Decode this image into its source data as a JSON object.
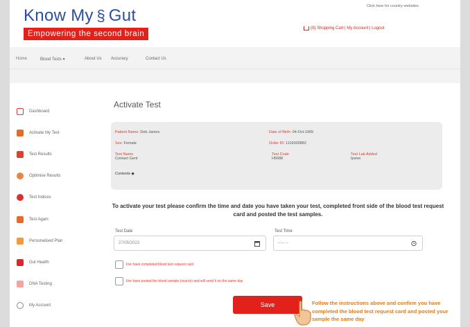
{
  "brand": {
    "name_part1": "Know My",
    "name_part2": "Gut",
    "tagline": "Empowering the second brain",
    "color": "#2a4f9e",
    "tag_color": "#e3211b"
  },
  "header": {
    "lang_link": "Click here for country websites",
    "cart_links": "(0) Shopping Cart | My Account | Logout"
  },
  "nav": {
    "items": [
      "Home",
      "Blood Tests ▾",
      "About Us",
      "Accuracy",
      "Contact Us"
    ]
  },
  "sidebar": {
    "items": [
      {
        "label": "Dashboard",
        "icon": "dashboard-icon"
      },
      {
        "label": "Activate My Test",
        "icon": "activate-icon"
      },
      {
        "label": "Test Results",
        "icon": "results-icon"
      },
      {
        "label": "Optimise Results",
        "icon": "optimise-icon"
      },
      {
        "label": "Test Indices",
        "icon": "indices-icon"
      },
      {
        "label": "Test Again",
        "icon": "test-again-icon"
      },
      {
        "label": "Personalised Plan",
        "icon": "plan-icon"
      },
      {
        "label": "Gut Health",
        "icon": "gut-icon"
      },
      {
        "label": "DNA Testing",
        "icon": "dna-icon"
      },
      {
        "label": "My Account",
        "icon": "account-icon"
      }
    ]
  },
  "main": {
    "title": "Activate Test",
    "patient": {
      "name_label": "Patient Name:",
      "name_value": "Deb James",
      "sex_label": "Sex:",
      "sex_value": "Female",
      "dob_label": "Date of Birth:",
      "dob_value": "04-Oct-1965",
      "order_label": "Order ID:",
      "order_value": "1116000882",
      "test_name_label": "Test Name",
      "test_name_value": "Contact Gent",
      "test_code_label": "Test Code",
      "test_code_value": "H5688",
      "lab_label": "Test Lab Added",
      "lab_value": "Ipsive",
      "cont_label": "Contents"
    },
    "instructions": "To activate your test please confirm the time and date you have taken your test, completed front side of the blood test request card and posted the test samples.",
    "test_date_label": "Test Date",
    "test_date_value": "27/05/2023",
    "test_time_label": "Test Time",
    "test_time_value": "--:-- --",
    "check1": "I/ve have completed blood test request card",
    "check2": "I/ve have posted the blood sample (source) and will send it on the same day",
    "save_label": "Save",
    "note": "Follow the instructions above and confirm you have completed the blood test request card and posted your sample the same day"
  }
}
